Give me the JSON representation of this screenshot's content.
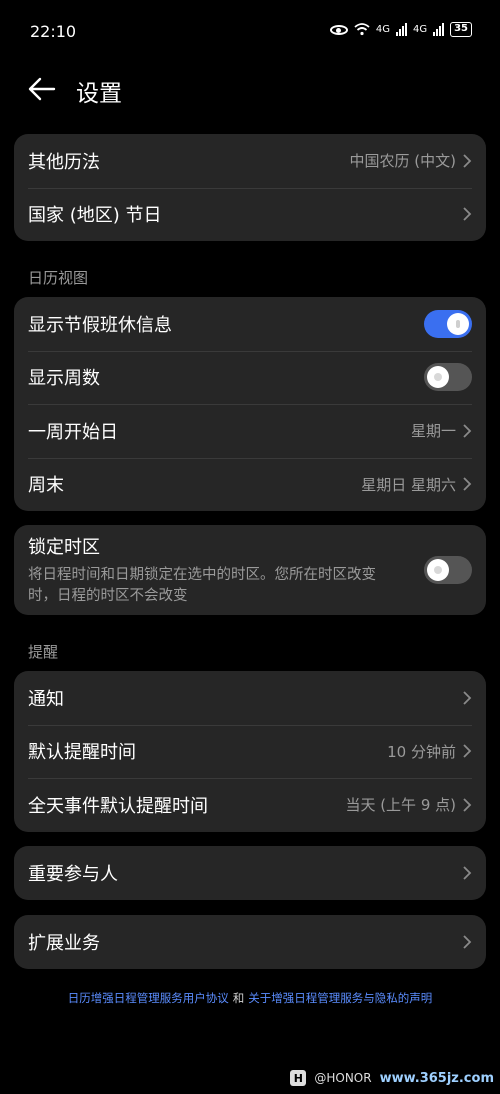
{
  "status": {
    "time": "22:10",
    "battery": "35",
    "net1": "4G",
    "net2": "4G"
  },
  "header": {
    "title": "设置"
  },
  "calendar_group": {
    "items": [
      {
        "label": "其他历法",
        "value": "中国农历 (中文)"
      },
      {
        "label": "国家 (地区) 节日",
        "value": ""
      }
    ]
  },
  "view_section": {
    "title": "日历视图",
    "holiday_info": {
      "label": "显示节假班休信息",
      "on": true
    },
    "week_number": {
      "label": "显示周数",
      "on": false
    },
    "week_start": {
      "label": "一周开始日",
      "value": "星期一"
    },
    "weekend": {
      "label": "周末",
      "value": "星期日 星期六"
    }
  },
  "timezone": {
    "title": "锁定时区",
    "description": "将日程时间和日期锁定在选中的时区。您所在时区改变时，日程的时区不会改变",
    "on": false
  },
  "reminder_section": {
    "title": "提醒",
    "notification": {
      "label": "通知"
    },
    "default_reminder": {
      "label": "默认提醒时间",
      "value": "10 分钟前"
    },
    "allday_reminder": {
      "label": "全天事件默认提醒时间",
      "value": "当天 (上午 9 点)"
    }
  },
  "important_people": {
    "label": "重要参与人"
  },
  "extension": {
    "label": "扩展业务"
  },
  "footer": {
    "link1": "日历增强日程管理服务用户协议",
    "and": "和",
    "link2": "关于增强日程管理服务与隐私的声明"
  },
  "watermark": {
    "logo": "H",
    "text": "@HONOR",
    "site": "www.365jz.com"
  },
  "colors": {
    "accent": "#3a6ff0",
    "link": "#5b8dff",
    "card": "#262626",
    "background": "#000000"
  }
}
